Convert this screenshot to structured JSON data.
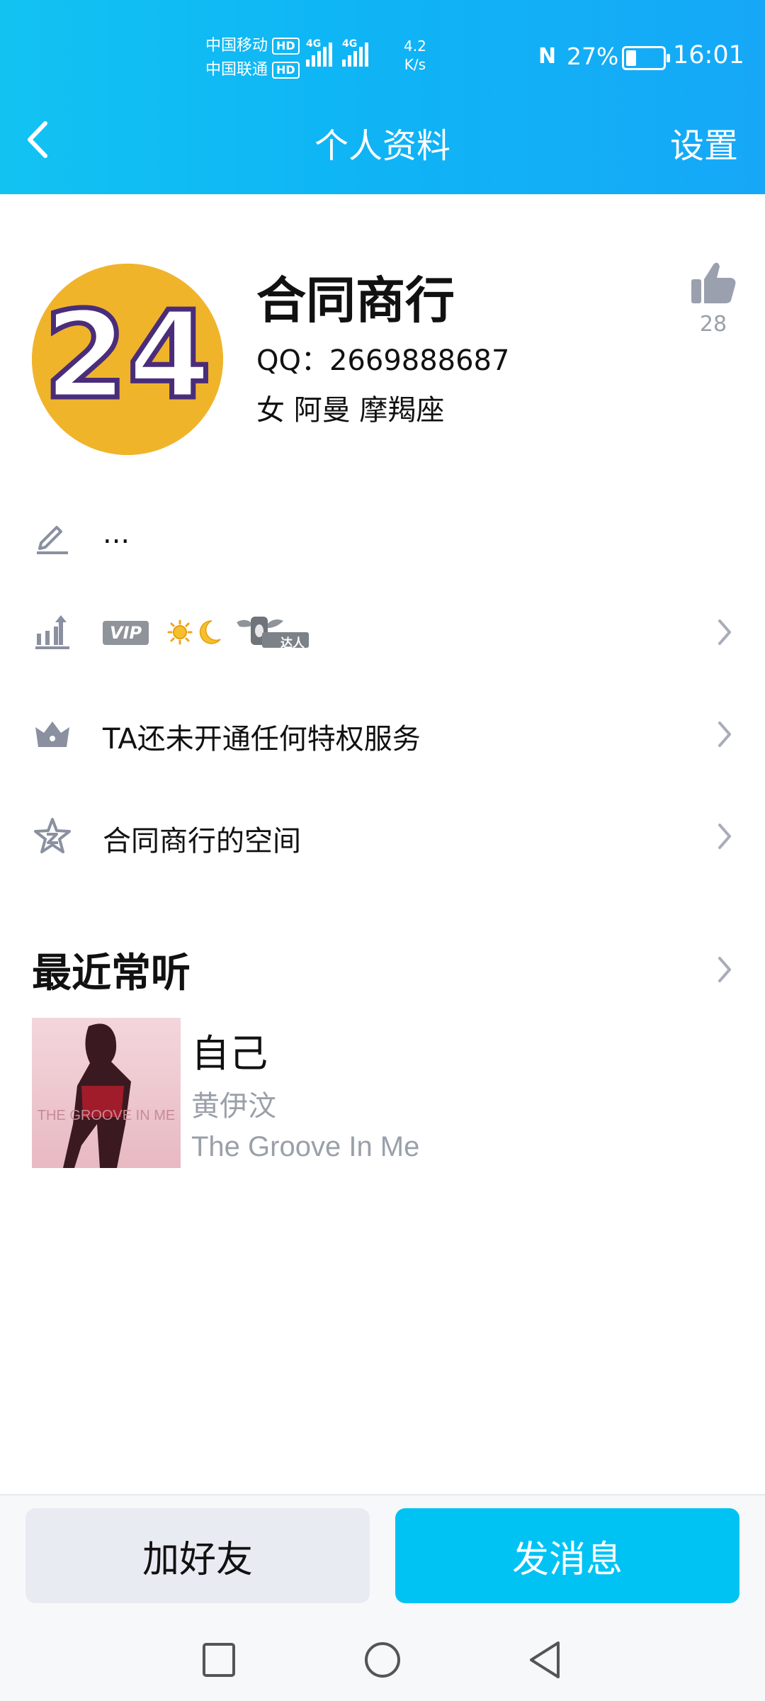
{
  "status_bar": {
    "carrier1": "中国移动",
    "carrier2": "中国联通",
    "hd": "HD",
    "net1": "4G",
    "net2": "4G",
    "speed_value": "4.2",
    "speed_unit": "K/s",
    "nfc": "N",
    "battery_pct": "27%",
    "battery_level": 0.27,
    "time": "16:01"
  },
  "nav": {
    "title": "个人资料",
    "settings_label": "设置",
    "back_icon": "chevron-left-icon"
  },
  "profile": {
    "avatar_text": "24",
    "nickname": "合同商行",
    "qq": "QQ：2669888687",
    "info": "女  阿曼  摩羯座",
    "like_count": "28"
  },
  "rows": {
    "signature": "...",
    "vip_badge": "VIP",
    "daren_label": "达人",
    "privilege": "TA还未开通任何特权服务",
    "space": "合同商行的空间"
  },
  "recent": {
    "section_title": "最近常听",
    "song_title": "自己",
    "song_artist": "黄伊汶",
    "song_album": "The Groove In Me",
    "cover_text": "THE GROOVE IN ME"
  },
  "actions": {
    "add_friend": "加好友",
    "send_message": "发消息"
  },
  "colors": {
    "header_start": "#12c3f2",
    "header_end": "#16a8f7",
    "primary": "#00c3f4",
    "secondary_bg": "#e9ebf3",
    "muted_text": "#9aa0aa",
    "avatar_bg": "#f0b42b"
  }
}
